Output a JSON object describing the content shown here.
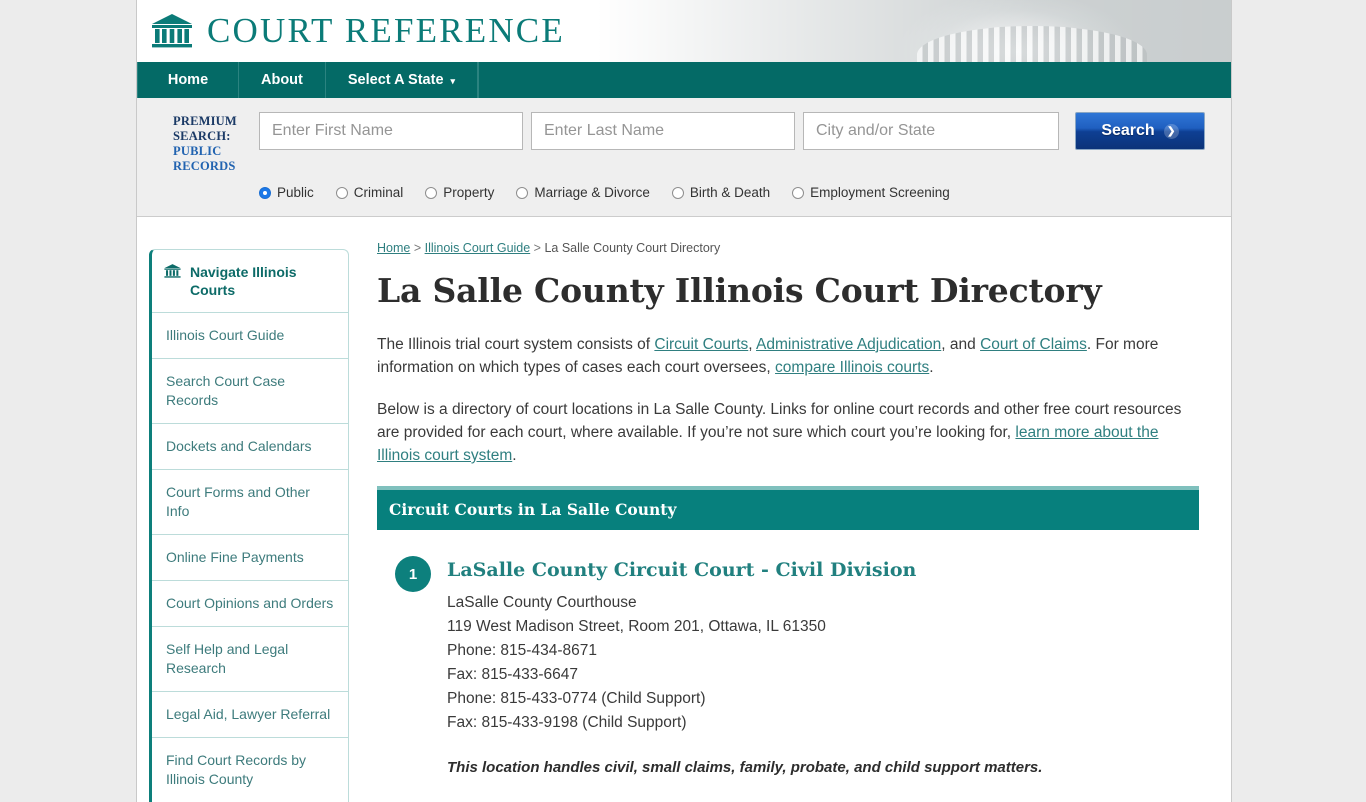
{
  "brand": {
    "name": "COURT REFERENCE",
    "icon": "courthouse-icon"
  },
  "nav": {
    "items": [
      {
        "label": "Home"
      },
      {
        "label": "About"
      },
      {
        "label": "Select A State",
        "caret": "▾"
      }
    ]
  },
  "premium_search": {
    "label_top": "PREMIUM SEARCH:",
    "label_bottom": "PUBLIC RECORDS",
    "first_name": {
      "value": "",
      "placeholder": "Enter First Name"
    },
    "last_name": {
      "value": "",
      "placeholder": "Enter Last Name"
    },
    "city_state": {
      "value": "",
      "placeholder": "City and/or State"
    },
    "search_button": "Search",
    "search_button_icon": "❯",
    "record_types": [
      {
        "label": "Public",
        "selected": true
      },
      {
        "label": "Criminal",
        "selected": false
      },
      {
        "label": "Property",
        "selected": false
      },
      {
        "label": "Marriage & Divorce",
        "selected": false
      },
      {
        "label": "Birth & Death",
        "selected": false
      },
      {
        "label": "Employment Screening",
        "selected": false
      }
    ]
  },
  "sidebar": {
    "header": "Navigate Illinois Courts",
    "header_icon": "courthouse-icon",
    "items": [
      {
        "label": "Illinois Court Guide"
      },
      {
        "label": "Search Court Case Records"
      },
      {
        "label": "Dockets and Calendars"
      },
      {
        "label": "Court Forms and Other Info"
      },
      {
        "label": "Online Fine Payments"
      },
      {
        "label": "Court Opinions and Orders"
      },
      {
        "label": "Self Help and Legal Research"
      },
      {
        "label": "Legal Aid, Lawyer Referral"
      },
      {
        "label": "Find Court Records by Illinois County"
      }
    ]
  },
  "breadcrumb": {
    "home": "Home",
    "sep1": " > ",
    "guide": "Illinois Court Guide",
    "sep2": " > ",
    "current": "La Salle County Court Directory"
  },
  "main": {
    "title": "La Salle County Illinois Court Directory",
    "paragraph1": {
      "t1": "The Illinois trial court system consists of ",
      "link1": "Circuit Courts",
      "t2": ", ",
      "link2": "Administrative Adjudication",
      "t3": ", and ",
      "link3": "Court of Claims",
      "t4": ". For more information on which types of cases each court oversees, ",
      "link4": "compare Illinois courts",
      "t5": "."
    },
    "paragraph2": {
      "t1": "Below is a directory of court locations in La Salle County. Links for online court records and other free court resources are provided for each court, where available. If you’re not sure which court you’re looking for, ",
      "link1": "learn more about the Illinois court system",
      "t2": "."
    },
    "section_banner": "Circuit Courts in La Salle County",
    "courts": [
      {
        "number": "1",
        "name": "LaSalle County Circuit Court - Civil Division",
        "lines": [
          "LaSalle County Courthouse",
          "119 West Madison Street, Room 201, Ottawa, IL 61350",
          "Phone: 815-434-8671",
          "Fax: 815-433-6647",
          "Phone: 815-433-0774 (Child Support)",
          "Fax: 815-433-9198 (Child Support)"
        ],
        "note": "This location handles civil, small claims, family, probate, and child support matters."
      }
    ]
  },
  "colors": {
    "teal": "#07807d",
    "teal_dark": "#046a66",
    "link": "#2f7f80",
    "button_blue": "#1f5fc0"
  }
}
